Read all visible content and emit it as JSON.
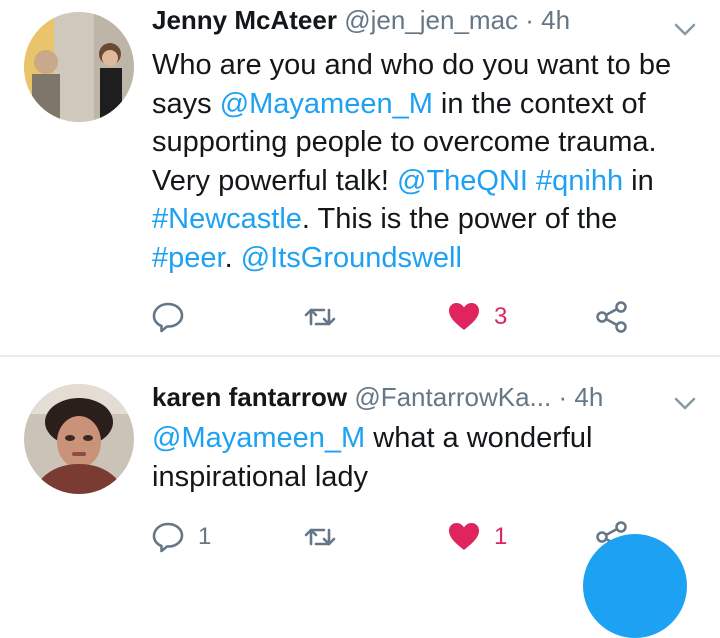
{
  "tweets": [
    {
      "name": "Jenny McAteer",
      "handle": "@jen_jen_mac",
      "sep": "·",
      "time": "4h",
      "body": [
        {
          "text": "Who are you and who do you want to be says ",
          "link": false
        },
        {
          "text": "@Mayameen_M",
          "link": true
        },
        {
          "text": " in the context of supporting people to overcome trauma. Very powerful talk! ",
          "link": false
        },
        {
          "text": "@TheQNI",
          "link": true
        },
        {
          "text": " ",
          "link": false
        },
        {
          "text": "#qnihh",
          "link": true
        },
        {
          "text": " in ",
          "link": false
        },
        {
          "text": "#Newcastle",
          "link": true
        },
        {
          "text": ". This is the power of the ",
          "link": false
        },
        {
          "text": "#peer",
          "link": true
        },
        {
          "text": ". ",
          "link": false
        },
        {
          "text": "@ItsGroundswell",
          "link": true
        }
      ],
      "reply_count": "",
      "retweet_count": "",
      "like_count": "3",
      "liked": true
    },
    {
      "name": "karen fantarrow",
      "handle": "@FantarrowKa...",
      "sep": "·",
      "time": "4h",
      "body": [
        {
          "text": "@Mayameen_M",
          "link": true
        },
        {
          "text": "  what a wonderful inspirational lady",
          "link": false
        }
      ],
      "reply_count": "1",
      "retweet_count": "",
      "like_count": "1",
      "liked": true
    }
  ],
  "icons": {
    "reply": "reply-icon",
    "retweet": "retweet-icon",
    "like": "heart-icon",
    "share": "share-icon",
    "more": "chevron-down-icon"
  },
  "colors": {
    "link": "#1da1f2",
    "like": "#e0245e",
    "muted": "#657786",
    "text": "#14171a"
  }
}
